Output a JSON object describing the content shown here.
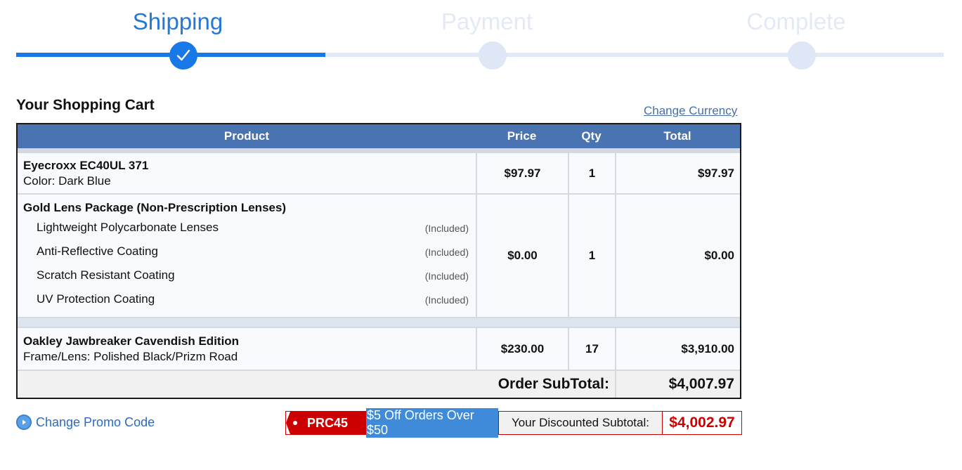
{
  "steps": [
    {
      "label": "Shipping",
      "state": "done"
    },
    {
      "label": "Payment",
      "state": "todo"
    },
    {
      "label": "Complete",
      "state": "todo"
    }
  ],
  "cart": {
    "title": "Your Shopping Cart",
    "change_currency": "Change Currency",
    "headers": {
      "product": "Product",
      "price": "Price",
      "qty": "Qty",
      "total": "Total"
    },
    "items": [
      {
        "name": "Eyecroxx EC40UL 371",
        "detail": "Color: Dark Blue",
        "price": "$97.97",
        "qty": "1",
        "total": "$97.97"
      },
      {
        "name": "Gold Lens Package (Non-Prescription Lenses)",
        "subitems": [
          {
            "label": "Lightweight Polycarbonate Lenses",
            "note": "(Included)"
          },
          {
            "label": "Anti-Reflective Coating",
            "note": "(Included)"
          },
          {
            "label": "Scratch Resistant Coating",
            "note": "(Included)"
          },
          {
            "label": "UV Protection Coating",
            "note": "(Included)"
          }
        ],
        "price": "$0.00",
        "qty": "1",
        "total": "$0.00"
      },
      {
        "name": "Oakley Jawbreaker Cavendish Edition",
        "detail": "Frame/Lens: Polished Black/Prizm Road",
        "price": "$230.00",
        "qty": "17",
        "total": "$3,910.00"
      }
    ],
    "subtotal_label": "Order SubTotal:",
    "subtotal_value": "$4,007.97"
  },
  "promo": {
    "change_link": "Change Promo Code",
    "code": "PRC45",
    "description": "$5 Off Orders Over $50",
    "discounted_label": "Your Discounted Subtotal:",
    "discounted_value": "$4,002.97"
  },
  "colors": {
    "accent": "#1878e8",
    "header": "#4a73b2",
    "promo_red": "#cc0000"
  }
}
